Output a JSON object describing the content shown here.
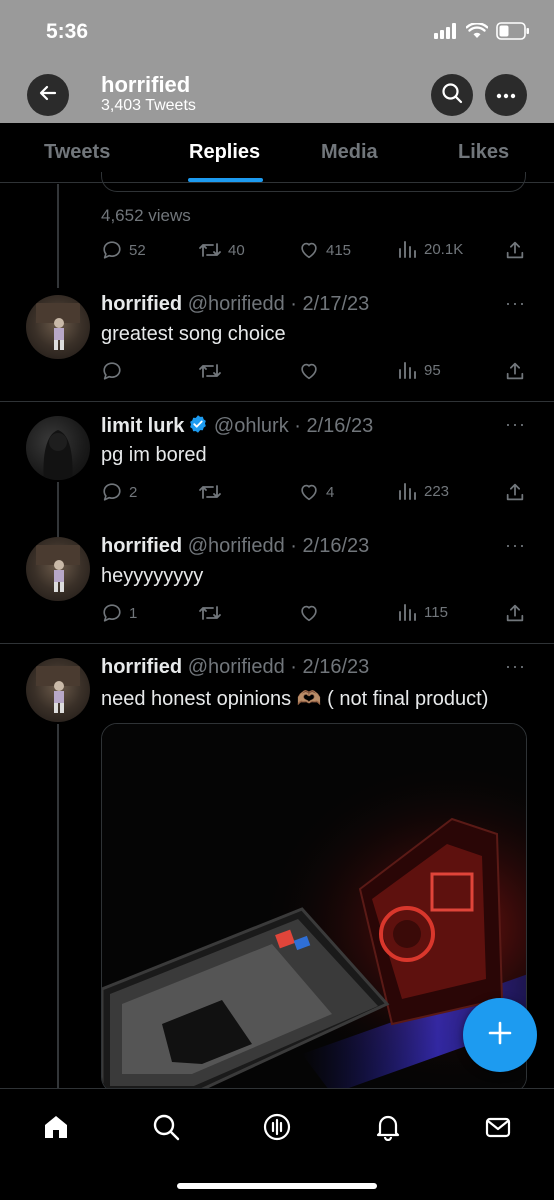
{
  "status_bar": {
    "time": "5:36"
  },
  "header": {
    "title": "horrified",
    "subtitle": "3,403 Tweets"
  },
  "tabs": [
    {
      "label": "Tweets",
      "active": false
    },
    {
      "label": "Replies",
      "active": true
    },
    {
      "label": "Media",
      "active": false
    },
    {
      "label": "Likes",
      "active": false
    }
  ],
  "prev_tweet": {
    "views": "4,652 views",
    "replies": "52",
    "retweets": "40",
    "likes": "415",
    "view_count": "20.1K"
  },
  "tweets": [
    {
      "name": "horrified",
      "handle": "@horifiedd",
      "date": "2/17/23",
      "text": "greatest song choice",
      "replies": "",
      "retweets": "",
      "likes": "",
      "views": "95",
      "verified": false
    },
    {
      "name": "limit lurk",
      "handle": "@ohlurk",
      "date": "2/16/23",
      "text": "pg im bored",
      "replies": "2",
      "retweets": "",
      "likes": "4",
      "views": "223",
      "verified": true
    },
    {
      "name": "horrified",
      "handle": "@horifiedd",
      "date": "2/16/23",
      "text": "heyyyyyyyy",
      "replies": "1",
      "retweets": "",
      "likes": "",
      "views": "115",
      "verified": false
    },
    {
      "name": "horrified",
      "handle": "@horifiedd",
      "date": "2/16/23",
      "text": "need honest opinions 🫶🏽 ( not final product)",
      "verified": false
    }
  ],
  "meta_sep": "·",
  "more_glyph": "···",
  "colors": {
    "accent": "#1d9bf0",
    "muted": "#71767b",
    "header_bg": "#9a9a9a"
  }
}
